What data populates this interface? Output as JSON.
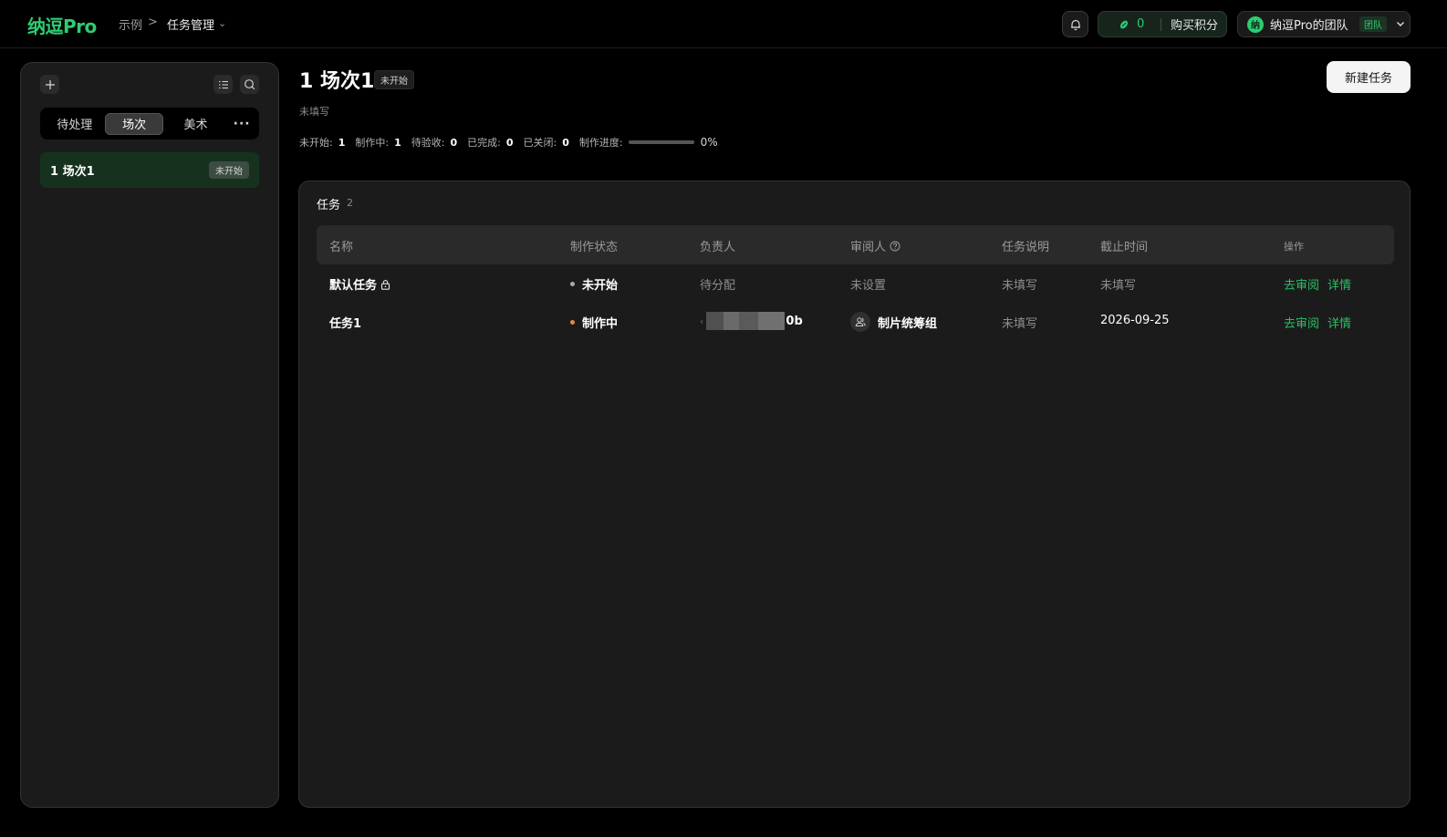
{
  "header": {
    "logo": "纳逗Pro",
    "breadcrumb": [
      "示例",
      "任务管理"
    ],
    "breadcrumb_sep": ">",
    "points_value": "0",
    "buy_points_label": "购买积分",
    "team_avatar": "纳",
    "team_name": "纳逗Pro的团队",
    "team_tag": "团队"
  },
  "sidebar": {
    "tabs": [
      "待处理",
      "场次",
      "美术"
    ],
    "active_tab": "场次",
    "more_label": "···",
    "scenes": [
      {
        "name": "1 场次1",
        "status": "未开始"
      }
    ]
  },
  "main": {
    "title": "1 场次1",
    "title_status": "未开始",
    "description": "未填写",
    "new_task_label": "新建任务",
    "stats": [
      {
        "label": "未开始:",
        "value": "1"
      },
      {
        "label": "制作中:",
        "value": "1"
      },
      {
        "label": "待验收:",
        "value": "0"
      },
      {
        "label": "已完成:",
        "value": "0"
      },
      {
        "label": "已关闭:",
        "value": "0"
      }
    ],
    "progress_label": "制作进度:",
    "progress_text": "0%",
    "progress_fraction": 0
  },
  "tasks": {
    "title": "任务",
    "count": "2",
    "columns": [
      "名称",
      "制作状态",
      "负责人",
      "审阅人",
      "任务说明",
      "截止时间",
      "操作"
    ],
    "rows": [
      {
        "name": "默认任务",
        "locked": true,
        "status": "未开始",
        "status_color": "#aaaaaa",
        "owner": "待分配",
        "reviewer": "未设置",
        "description": "未填写",
        "deadline": "未填写",
        "ops": [
          "去审阅",
          "详情"
        ]
      },
      {
        "name": "任务1",
        "locked": false,
        "status": "制作中",
        "status_color": "#f0873a",
        "owner_prefix": "‹",
        "owner_suffix": "0b",
        "reviewer": "制片统筹组",
        "description": "未填写",
        "deadline": "2026-09-25",
        "ops": [
          "去审阅",
          "详情"
        ]
      }
    ]
  },
  "colors": {
    "accent": "#2ecc71",
    "link": "#27c162"
  }
}
